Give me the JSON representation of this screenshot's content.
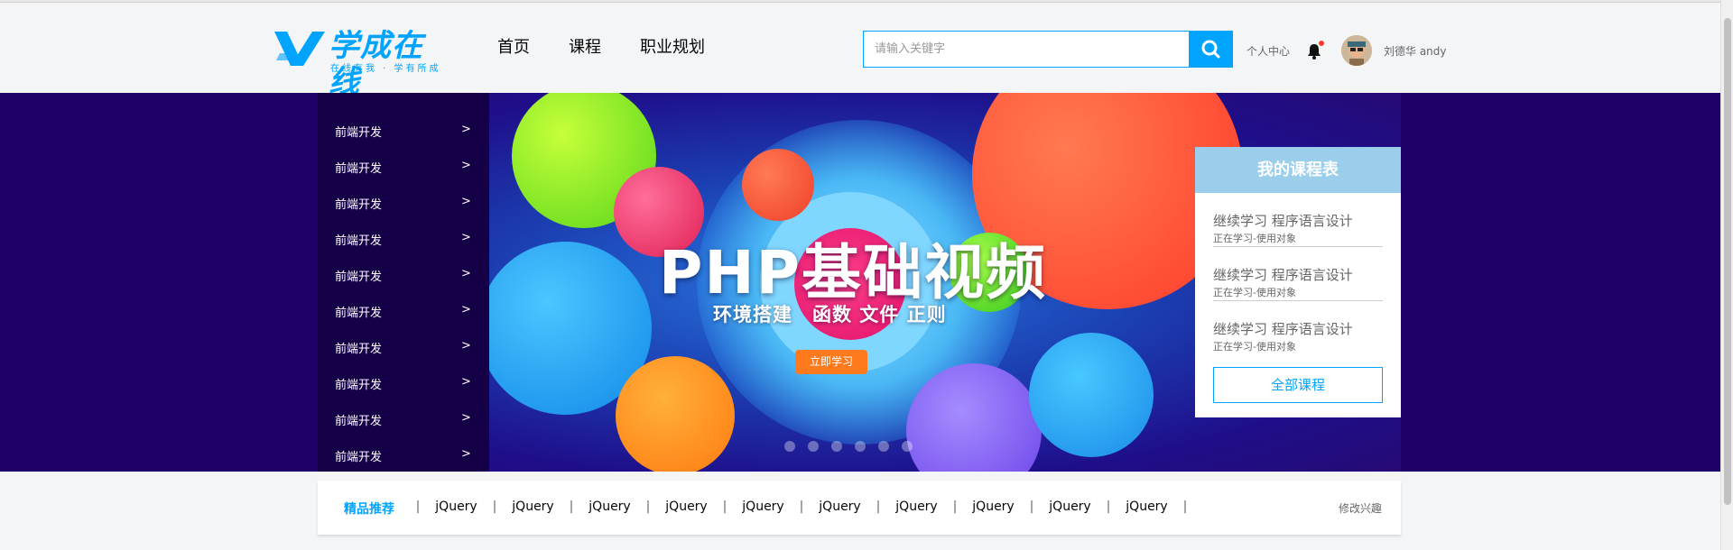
{
  "header": {
    "logo_text": "学成在线",
    "logo_slogan": "在线有我 · 学有所成",
    "nav": [
      "首页",
      "课程",
      "职业规划"
    ],
    "search_placeholder": "请输入关键字",
    "user_center": "个人中心",
    "username": "刘德华 andy",
    "brand_color": "#00a4ff"
  },
  "banner": {
    "menu": [
      "前端开发",
      "前端开发",
      "前端开发",
      "前端开发",
      "前端开发",
      "前端开发",
      "前端开发",
      "前端开发",
      "前端开发",
      "前端开发"
    ],
    "menu_arrow": ">",
    "headline": "PHP基础视频",
    "subline": "环境搭建　函数  文件  正则",
    "cta": "立即学习",
    "slide_count": 6,
    "background": "#1f0068"
  },
  "schedule": {
    "title": "我的课程表",
    "entries": [
      {
        "course": "继续学习 程序语言设计",
        "status": "正在学习-使用对象"
      },
      {
        "course": "继续学习 程序语言设计",
        "status": "正在学习-使用对象"
      },
      {
        "course": "继续学习 程序语言设计",
        "status": "正在学习-使用对象"
      }
    ],
    "all_courses": "全部课程"
  },
  "recommend": {
    "title": "精品推荐",
    "separator": "|",
    "links": [
      "jQuery",
      "jQuery",
      "jQuery",
      "jQuery",
      "jQuery",
      "jQuery",
      "jQuery",
      "jQuery",
      "jQuery",
      "jQuery"
    ],
    "modify": "修改兴趣"
  }
}
